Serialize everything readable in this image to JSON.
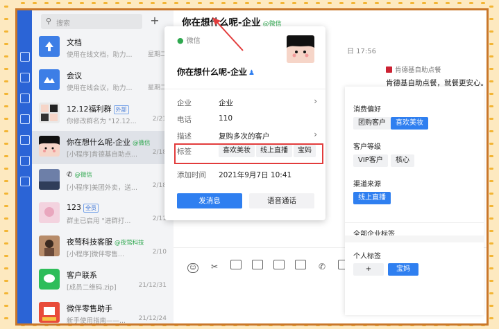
{
  "search": {
    "placeholder": "搜索",
    "add_label": "+"
  },
  "conversations": [
    {
      "name": "文档",
      "preview": "使用在线文档，助力...",
      "time": "星期二",
      "badge": "",
      "channel": ""
    },
    {
      "name": "会议",
      "preview": "使用在线会议，助力...",
      "time": "星期二",
      "badge": "",
      "channel": ""
    },
    {
      "name": "12.12福利群",
      "preview": "你修改群名为 \"12.12...",
      "time": "2/21",
      "badge": "外部",
      "channel": ""
    },
    {
      "name": "你在想什么呢-企业",
      "preview": "[小程序]肯德基自助点...",
      "time": "2/18",
      "badge": "",
      "channel": "@微信"
    },
    {
      "name": "",
      "preview": "[小程序]美团外卖，送...",
      "time": "2/18",
      "badge": "",
      "channel": "@微信"
    },
    {
      "name": "123",
      "preview": "群主已启用 \"进群打...",
      "time": "2/11",
      "badge": "全员",
      "channel": ""
    },
    {
      "name": "夜莺科技客服",
      "preview": "[小程序]微伴零售...",
      "time": "2/10",
      "badge": "",
      "channel": "@夜莺科技"
    },
    {
      "name": "客户联系",
      "preview": "[成员二维码.zip]",
      "time": "21/12/31",
      "badge": "",
      "channel": ""
    },
    {
      "name": "微伴零售助手",
      "preview": "新手使用指南——...",
      "time": "21/12/24",
      "badge": "",
      "channel": ""
    }
  ],
  "chat": {
    "title": "你在想什么呢-企业",
    "channel": "@微信",
    "timestamp": "日 17:56",
    "card_sender": "肯德基自助点餐",
    "card_body": "肯德基自助点餐，就餐更安心。"
  },
  "popup": {
    "source": "微信",
    "name": "你在想什么呢-企业",
    "rows": {
      "company": {
        "key": "企业",
        "value": "企业"
      },
      "phone": {
        "key": "电话",
        "value": "110"
      },
      "desc": {
        "key": "描述",
        "value": "复购多次的客户"
      },
      "tags": {
        "key": "标签",
        "chips": [
          "喜欢美妆",
          "线上直播",
          "宝妈"
        ]
      },
      "added": {
        "key": "添加时间",
        "value": "2021年9月7日 10:41"
      }
    },
    "send_button": "发消息",
    "call_button": "语音通话"
  },
  "tag_panel": {
    "groups": [
      {
        "title": "消费偏好",
        "tags": [
          {
            "label": "团购客户",
            "on": false
          },
          {
            "label": "喜欢美妆",
            "on": true
          }
        ]
      },
      {
        "title": "客户等级",
        "tags": [
          {
            "label": "VIP客户",
            "on": false
          },
          {
            "label": "核心",
            "on": false
          }
        ]
      },
      {
        "title": "渠道来源",
        "tags": [
          {
            "label": "线上直播",
            "on": true
          }
        ]
      }
    ],
    "all_tags_label": "全部企业标签",
    "personal_title": "个人标签",
    "personal_add": "+",
    "personal_tags": [
      {
        "label": "宝妈",
        "on": true
      }
    ]
  },
  "colors": {
    "accent": "#2f7ff0",
    "rail": "#2b64d6",
    "highlight": "#e23b3b",
    "frame": "#fde9c0",
    "wechat": "#2fa84f"
  }
}
